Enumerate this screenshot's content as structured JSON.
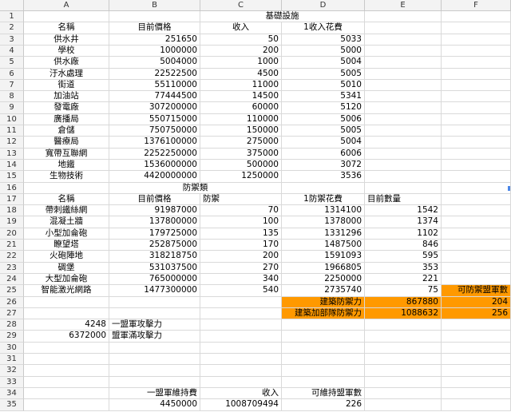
{
  "columns": [
    "A",
    "B",
    "C",
    "D",
    "E",
    "F"
  ],
  "rows": [
    {
      "n": "1",
      "cells": [
        null,
        null,
        {
          "t": "基礎設施",
          "span": 2,
          "align": "ctr"
        },
        null,
        null,
        null
      ]
    },
    {
      "n": "2",
      "cells": [
        {
          "t": "名稱",
          "align": "ctr"
        },
        {
          "t": "目前價格",
          "align": "ctr"
        },
        {
          "t": "收入",
          "align": "ctr"
        },
        {
          "t": "1收入花費",
          "align": "ctr"
        },
        null,
        null
      ]
    },
    {
      "n": "3",
      "cells": [
        {
          "t": "供水井",
          "align": "ctr"
        },
        {
          "t": "251650",
          "align": "num"
        },
        {
          "t": "50",
          "align": "num"
        },
        {
          "t": "5033",
          "align": "num"
        },
        null,
        null
      ]
    },
    {
      "n": "4",
      "cells": [
        {
          "t": "學校",
          "align": "ctr"
        },
        {
          "t": "1000000",
          "align": "num"
        },
        {
          "t": "200",
          "align": "num"
        },
        {
          "t": "5000",
          "align": "num"
        },
        null,
        null
      ]
    },
    {
      "n": "5",
      "cells": [
        {
          "t": "供水廠",
          "align": "ctr"
        },
        {
          "t": "5004000",
          "align": "num"
        },
        {
          "t": "1000",
          "align": "num"
        },
        {
          "t": "5004",
          "align": "num"
        },
        null,
        null
      ]
    },
    {
      "n": "6",
      "cells": [
        {
          "t": "汙水處理",
          "align": "ctr"
        },
        {
          "t": "22522500",
          "align": "num"
        },
        {
          "t": "4500",
          "align": "num"
        },
        {
          "t": "5005",
          "align": "num"
        },
        null,
        null
      ]
    },
    {
      "n": "7",
      "cells": [
        {
          "t": "街道",
          "align": "ctr"
        },
        {
          "t": "55110000",
          "align": "num"
        },
        {
          "t": "11000",
          "align": "num"
        },
        {
          "t": "5010",
          "align": "num"
        },
        null,
        null
      ]
    },
    {
      "n": "8",
      "cells": [
        {
          "t": "加油站",
          "align": "ctr"
        },
        {
          "t": "77444500",
          "align": "num"
        },
        {
          "t": "14500",
          "align": "num"
        },
        {
          "t": "5341",
          "align": "num"
        },
        null,
        null
      ]
    },
    {
      "n": "9",
      "cells": [
        {
          "t": "發電廠",
          "align": "ctr"
        },
        {
          "t": "307200000",
          "align": "num"
        },
        {
          "t": "60000",
          "align": "num"
        },
        {
          "t": "5120",
          "align": "num"
        },
        null,
        null
      ]
    },
    {
      "n": "10",
      "cells": [
        {
          "t": "廣播局",
          "align": "ctr"
        },
        {
          "t": "550715000",
          "align": "num"
        },
        {
          "t": "110000",
          "align": "num"
        },
        {
          "t": "5006",
          "align": "num"
        },
        null,
        null
      ]
    },
    {
      "n": "11",
      "cells": [
        {
          "t": "倉儲",
          "align": "ctr"
        },
        {
          "t": "750750000",
          "align": "num"
        },
        {
          "t": "150000",
          "align": "num"
        },
        {
          "t": "5005",
          "align": "num"
        },
        null,
        null
      ]
    },
    {
      "n": "12",
      "cells": [
        {
          "t": "醫療局",
          "align": "ctr"
        },
        {
          "t": "1376100000",
          "align": "num"
        },
        {
          "t": "275000",
          "align": "num"
        },
        {
          "t": "5004",
          "align": "num"
        },
        null,
        null
      ]
    },
    {
      "n": "13",
      "cells": [
        {
          "t": "寬帶互聯網",
          "align": "ctr"
        },
        {
          "t": "2252250000",
          "align": "num"
        },
        {
          "t": "375000",
          "align": "num"
        },
        {
          "t": "6006",
          "align": "num"
        },
        null,
        null
      ]
    },
    {
      "n": "14",
      "cells": [
        {
          "t": "地鐵",
          "align": "ctr"
        },
        {
          "t": "1536000000",
          "align": "num"
        },
        {
          "t": "500000",
          "align": "num"
        },
        {
          "t": "3072",
          "align": "num"
        },
        null,
        null
      ]
    },
    {
      "n": "15",
      "cells": [
        {
          "t": "生物技術",
          "align": "ctr"
        },
        {
          "t": "4420000000",
          "align": "num"
        },
        {
          "t": "1250000",
          "align": "num"
        },
        {
          "t": "3536",
          "align": "num"
        },
        null,
        null
      ]
    },
    {
      "n": "16",
      "cells": [
        null,
        {
          "t": "防禦類",
          "span": 2,
          "align": "ctr"
        },
        null,
        null,
        null,
        null
      ]
    },
    {
      "n": "17",
      "cells": [
        {
          "t": "名稱",
          "align": "ctr"
        },
        {
          "t": "目前價格",
          "align": "ctr"
        },
        {
          "t": "防禦",
          "align": "lft"
        },
        {
          "t": "1防禦花費",
          "align": "ctr"
        },
        {
          "t": "目前數量",
          "align": "lft"
        },
        null
      ]
    },
    {
      "n": "18",
      "cells": [
        {
          "t": "帶刺鐵絲網",
          "align": "ctr"
        },
        {
          "t": "91987000",
          "align": "num"
        },
        {
          "t": "70",
          "align": "num"
        },
        {
          "t": "1314100",
          "align": "num"
        },
        {
          "t": "1542",
          "align": "num"
        },
        null
      ]
    },
    {
      "n": "19",
      "cells": [
        {
          "t": "混凝土牆",
          "align": "ctr"
        },
        {
          "t": "137800000",
          "align": "num"
        },
        {
          "t": "100",
          "align": "num"
        },
        {
          "t": "1378000",
          "align": "num"
        },
        {
          "t": "1374",
          "align": "num"
        },
        null
      ]
    },
    {
      "n": "20",
      "cells": [
        {
          "t": "小型加侖砲",
          "align": "ctr"
        },
        {
          "t": "179725000",
          "align": "num"
        },
        {
          "t": "135",
          "align": "num"
        },
        {
          "t": "1331296",
          "align": "num"
        },
        {
          "t": "1102",
          "align": "num"
        },
        null
      ]
    },
    {
      "n": "21",
      "cells": [
        {
          "t": "瞭望塔",
          "align": "ctr"
        },
        {
          "t": "252875000",
          "align": "num"
        },
        {
          "t": "170",
          "align": "num"
        },
        {
          "t": "1487500",
          "align": "num"
        },
        {
          "t": "846",
          "align": "num"
        },
        null
      ]
    },
    {
      "n": "22",
      "cells": [
        {
          "t": "火砲陣地",
          "align": "ctr"
        },
        {
          "t": "318218750",
          "align": "num"
        },
        {
          "t": "200",
          "align": "num"
        },
        {
          "t": "1591093",
          "align": "num"
        },
        {
          "t": "595",
          "align": "num"
        },
        null
      ]
    },
    {
      "n": "23",
      "cells": [
        {
          "t": "碉堡",
          "align": "ctr"
        },
        {
          "t": "531037500",
          "align": "num"
        },
        {
          "t": "270",
          "align": "num"
        },
        {
          "t": "1966805",
          "align": "num"
        },
        {
          "t": "353",
          "align": "num"
        },
        null
      ]
    },
    {
      "n": "24",
      "cells": [
        {
          "t": "大型加侖砲",
          "align": "ctr"
        },
        {
          "t": "765000000",
          "align": "num"
        },
        {
          "t": "340",
          "align": "num"
        },
        {
          "t": "2250000",
          "align": "num"
        },
        {
          "t": "221",
          "align": "num"
        },
        null
      ]
    },
    {
      "n": "25",
      "cells": [
        {
          "t": "智能激光網路",
          "align": "ctr"
        },
        {
          "t": "1477300000",
          "align": "num"
        },
        {
          "t": "540",
          "align": "num"
        },
        {
          "t": "2735740",
          "align": "num"
        },
        {
          "t": "75",
          "align": "num"
        },
        {
          "t": "可防禦盟軍數",
          "align": "num",
          "orange": true
        }
      ]
    },
    {
      "n": "26",
      "cells": [
        null,
        null,
        null,
        {
          "t": "建築防禦力",
          "align": "num",
          "orange": true
        },
        {
          "t": "867880",
          "align": "num",
          "orange": true
        },
        {
          "t": "204",
          "align": "num",
          "orange": true
        }
      ]
    },
    {
      "n": "27",
      "cells": [
        null,
        null,
        null,
        {
          "t": "建築加部隊防禦力",
          "align": "num",
          "orange": true
        },
        {
          "t": "1088632",
          "align": "num",
          "orange": true
        },
        {
          "t": "256",
          "align": "num",
          "orange": true
        }
      ]
    },
    {
      "n": "28",
      "cells": [
        {
          "t": "4248",
          "align": "num"
        },
        {
          "t": "一盟軍攻擊力",
          "align": "lft"
        },
        null,
        null,
        null,
        null
      ]
    },
    {
      "n": "29",
      "cells": [
        {
          "t": "6372000",
          "align": "num"
        },
        {
          "t": "盟軍滿攻擊力",
          "align": "lft"
        },
        null,
        null,
        null,
        null
      ]
    },
    {
      "n": "30",
      "cells": [
        null,
        null,
        null,
        null,
        null,
        null
      ]
    },
    {
      "n": "31",
      "cells": [
        null,
        null,
        null,
        null,
        null,
        null
      ]
    },
    {
      "n": "32",
      "cells": [
        null,
        null,
        null,
        null,
        null,
        null
      ]
    },
    {
      "n": "33",
      "cells": [
        null,
        null,
        null,
        null,
        null,
        null
      ]
    },
    {
      "n": "34",
      "cells": [
        null,
        {
          "t": "一盟軍維持費",
          "align": "num"
        },
        {
          "t": "收入",
          "align": "num"
        },
        {
          "t": "可維持盟軍數",
          "align": "num"
        },
        null,
        null
      ]
    },
    {
      "n": "35",
      "cells": [
        null,
        {
          "t": "4450000",
          "align": "num"
        },
        {
          "t": "1008709494",
          "align": "num"
        },
        {
          "t": "226",
          "align": "num"
        },
        null,
        null
      ]
    }
  ]
}
